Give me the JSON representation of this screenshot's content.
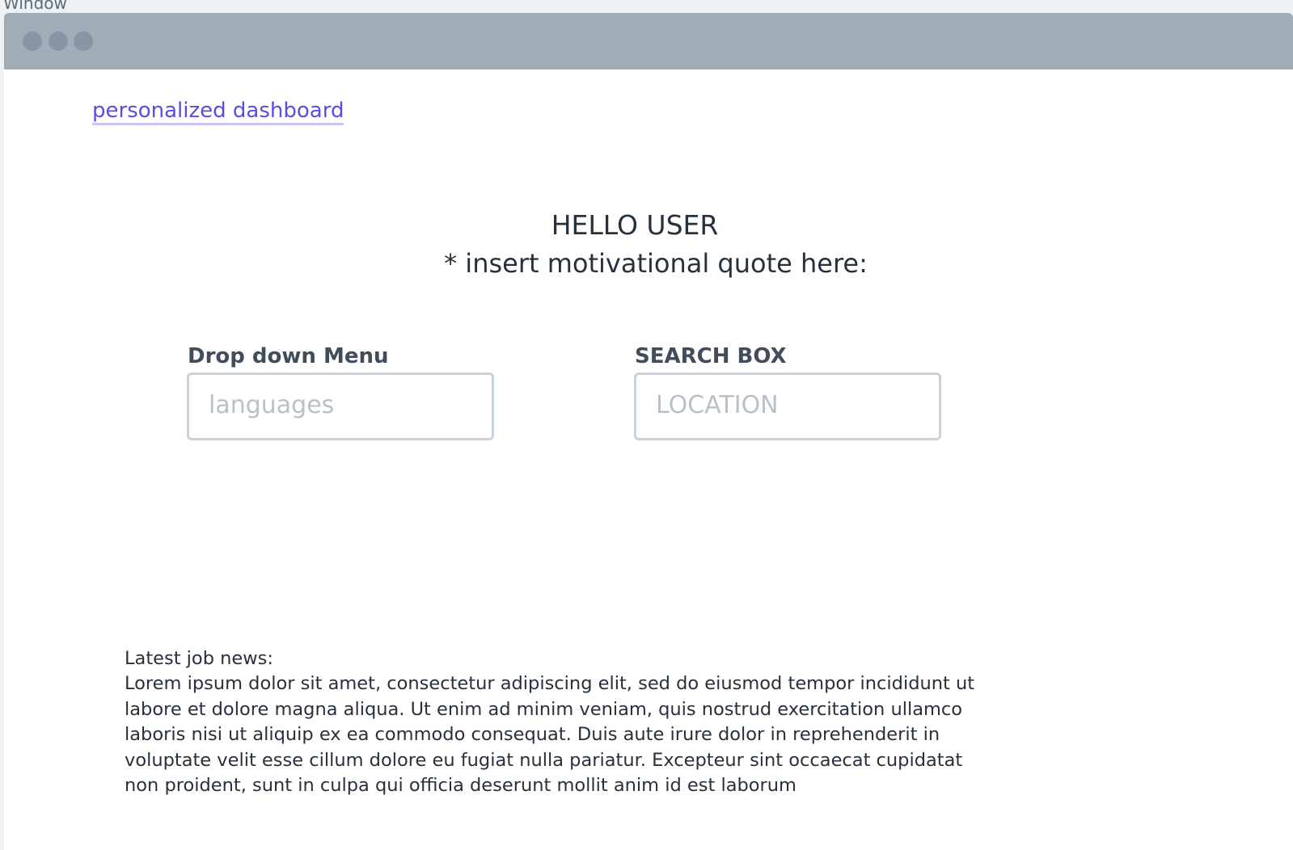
{
  "frame": {
    "label": "Window"
  },
  "window": {
    "controls": [
      "close-dot",
      "minimize-dot",
      "maximize-dot"
    ]
  },
  "nav": {
    "link_label": "personalized dashboard"
  },
  "hero": {
    "greeting": "HELLO USER",
    "quote": "* insert motivational quote here:"
  },
  "dropdown": {
    "label": "Drop down Menu",
    "placeholder": "languages"
  },
  "search": {
    "label": "SEARCH BOX",
    "placeholder": "LOCATION"
  },
  "news": {
    "heading": "Latest job news:",
    "body": "Lorem ipsum dolor sit amet, consectetur adipiscing elit, sed do eiusmod tempor incididunt ut labore et dolore magna aliqua. Ut enim ad minim veniam, quis nostrud exercitation ullamco laboris nisi ut aliquip ex ea commodo consequat. Duis aute irure dolor in reprehenderit in voluptate velit esse cillum dolore eu fugiat nulla pariatur. Excepteur sint occaecat cupidatat non proident, sunt in culpa qui officia deserunt mollit anim id est laborum"
  },
  "colors": {
    "accent": "#5b4de2",
    "titlebar": "#a0adb9",
    "field_border": "#c9d1d9",
    "text": "#26313d"
  }
}
